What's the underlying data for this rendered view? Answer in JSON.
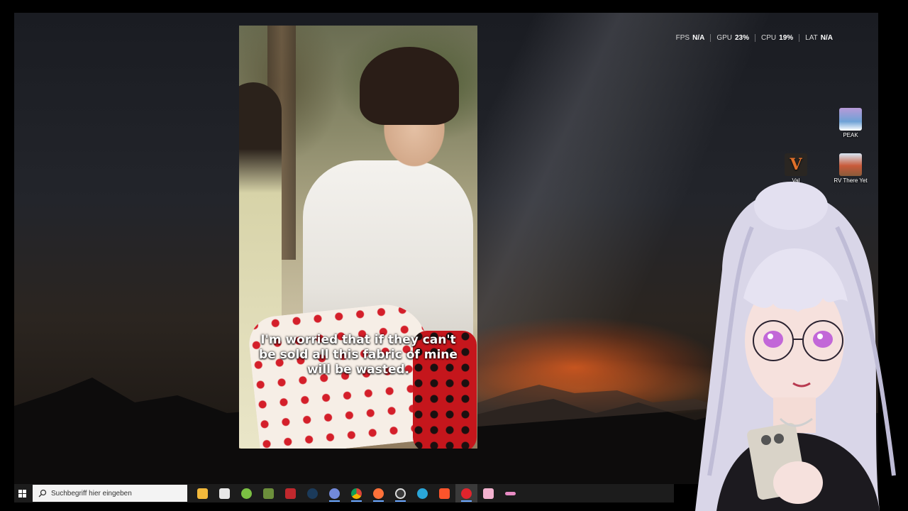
{
  "overlay": {
    "fps_label": "FPS",
    "fps_value": "N/A",
    "gpu_label": "GPU",
    "gpu_value": "23%",
    "cpu_label": "CPU",
    "cpu_value": "19%",
    "lat_label": "LAT",
    "lat_value": "N/A"
  },
  "desktop_icons": {
    "peak": "PEAK",
    "rv_there_yet": "RV There Yet",
    "valheim_partial": "Val"
  },
  "video": {
    "subtitle_line1": "I'm worried that if they can't",
    "subtitle_line2": "be sold all this fabric of mine",
    "subtitle_line3": "will be wasted."
  },
  "taskbar": {
    "search_placeholder": "Suchbegriff hier eingeben",
    "icons": [
      {
        "name": "file-explorer-icon",
        "color": "#f2b93b"
      },
      {
        "name": "store-icon",
        "color": "#e8e8e8"
      },
      {
        "name": "android-icon",
        "color": "#7bc043"
      },
      {
        "name": "minecraft-icon",
        "color": "#6c8f3b"
      },
      {
        "name": "news-app-icon",
        "color": "#c0282d"
      },
      {
        "name": "steam-icon",
        "color": "#1b3a5a"
      },
      {
        "name": "discord-icon",
        "color": "#7289da"
      },
      {
        "name": "chrome-icon",
        "color": "#e8b339"
      },
      {
        "name": "firefox-icon",
        "color": "#ff7139"
      },
      {
        "name": "obs-icon",
        "color": "#3a3a3a"
      },
      {
        "name": "app-blue-icon",
        "color": "#2aa6d9"
      },
      {
        "name": "brave-icon",
        "color": "#fb542b"
      },
      {
        "name": "opera-icon",
        "color": "#e0242c"
      },
      {
        "name": "pink-app-icon",
        "color": "#f3b2cf"
      },
      {
        "name": "pen-app-icon",
        "color": "#e88bc4"
      }
    ]
  },
  "colors": {
    "taskbar_bg": "#1c1c1c",
    "accent": "#6aa7ff"
  }
}
